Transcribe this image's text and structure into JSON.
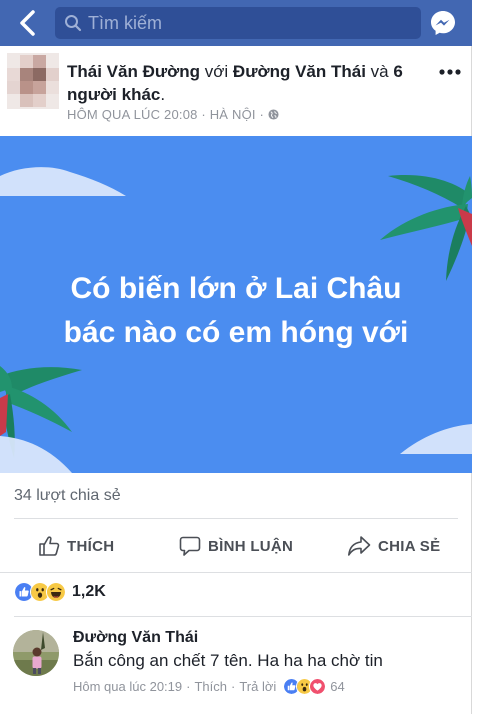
{
  "topbar": {
    "search_placeholder": "Tìm kiếm",
    "color": "#4267b2"
  },
  "post": {
    "author": "Thái Văn Đường",
    "with_word": "với",
    "tagged": "Đường Văn Thái",
    "and_word": "và",
    "others": "6 người khác",
    "period": ".",
    "timestamp": "HÔM QUA LÚC 20:08",
    "location": "HÀ NỘI",
    "privacy_icon": "globe-icon",
    "banner_line1": "Có biến lớn ở Lai Châu",
    "banner_line2": "bác nào có em hóng với",
    "banner_color": "#4b8df0",
    "share_count": "34 lượt chia sẻ"
  },
  "actions": {
    "like": "THÍCH",
    "comment": "BÌNH LUẬN",
    "share": "CHIA SẺ"
  },
  "reactions": {
    "icons": [
      "like-icon",
      "wow-icon",
      "haha-icon"
    ],
    "count": "1,2K"
  },
  "comment": {
    "author": "Đường Văn Thái",
    "text": "Bắn công an chết 7 tên. Ha ha ha chờ tin",
    "time": "Hôm qua lúc 20:19",
    "like_label": "Thích",
    "reply_label": "Trả lời",
    "separator": "·",
    "reaction_icons": [
      "like-icon",
      "wow-icon",
      "love-icon"
    ],
    "reaction_count": "64"
  }
}
